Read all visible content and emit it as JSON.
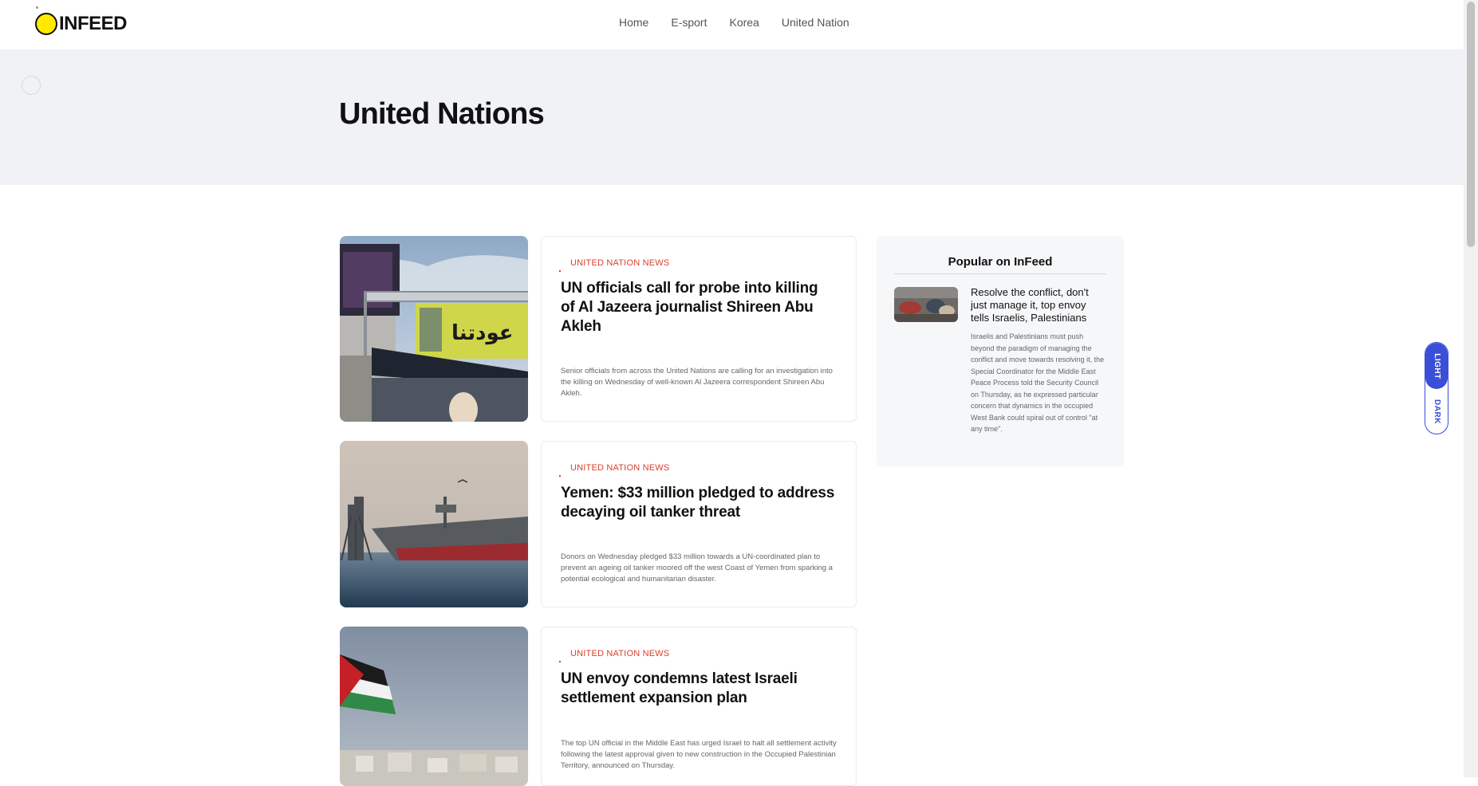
{
  "header": {
    "logo_text": "INFEED",
    "nav": [
      "Home",
      "E-sport",
      "Korea",
      "United Nation"
    ]
  },
  "hero": {
    "title": "United Nations"
  },
  "articles": [
    {
      "category": "UNITED NATION NEWS",
      "title": "UN officials call for probe into killing of Al Jazeera journalist Shireen Abu Akleh",
      "excerpt": "Senior officials from across the United Nations are calling for an investigation into the killing on Wednesday of well-known Al Jazeera correspondent Shireen Abu Akleh."
    },
    {
      "category": "UNITED NATION NEWS",
      "title": "Yemen: $33 million pledged to address decaying oil tanker threat",
      "excerpt": "Donors on Wednesday pledged $33 million towards a UN-coordinated plan to prevent an ageing oil tanker moored off the west Coast of Yemen from sparking a potential ecological and humanitarian disaster."
    },
    {
      "category": "UNITED NATION NEWS",
      "title": "UN envoy condemns latest Israeli settlement expansion plan",
      "excerpt": "The top UN official in the Middle East has urged Israel to halt all settlement activity following the latest approval given to new construction in the Occupied Palestinian Territory, announced on Thursday."
    }
  ],
  "sidebar": {
    "title": "Popular on InFeed",
    "item": {
      "headline": "Resolve the conflict, don't just manage it, top envoy tells Israelis, Palestinians",
      "excerpt": "Israelis and Palestinians must push beyond the paradigm of managing the conflict and move towards resolving it, the Special Coordinator for the Middle East Peace Process told the Security Council on Thursday, as he expressed particular concern that dynamics in the occupied West Bank could spiral out of control \"at any time\"."
    }
  },
  "theme_toggle": {
    "light": "LIGHT",
    "dark": "DARK"
  },
  "colors": {
    "accent": "#3a4ed8",
    "category": "#d8412f",
    "logo": "#ffea00",
    "hero_bg": "#f1f2f5"
  }
}
